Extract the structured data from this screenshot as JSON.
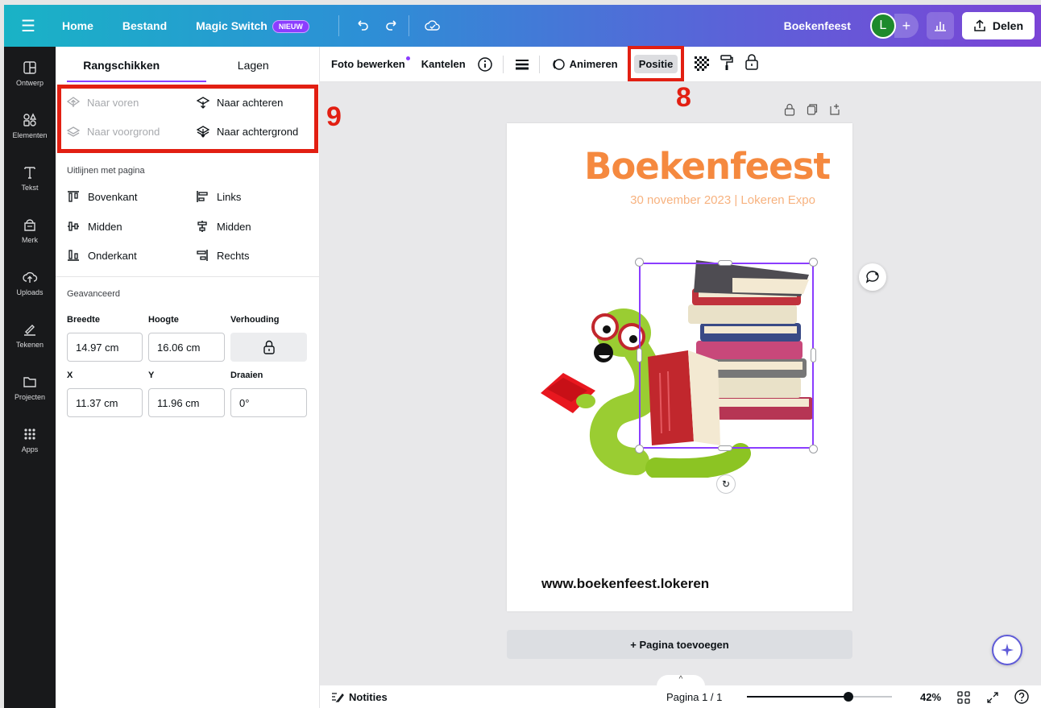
{
  "topbar": {
    "home": "Home",
    "file": "Bestand",
    "magic_switch": "Magic Switch",
    "new_badge": "NIEUW",
    "doc_title": "Boekenfeest",
    "avatar_initial": "L",
    "share": "Delen"
  },
  "rail": [
    {
      "label": "Ontwerp",
      "icon": "layout-icon"
    },
    {
      "label": "Elementen",
      "icon": "shapes-icon"
    },
    {
      "label": "Tekst",
      "icon": "text-icon"
    },
    {
      "label": "Merk",
      "icon": "brand-icon"
    },
    {
      "label": "Uploads",
      "icon": "cloud-upload-icon"
    },
    {
      "label": "Tekenen",
      "icon": "draw-icon"
    },
    {
      "label": "Projecten",
      "icon": "folder-icon"
    },
    {
      "label": "Apps",
      "icon": "apps-grid-icon"
    }
  ],
  "panel": {
    "tab_arrange": "Rangschikken",
    "tab_layers": "Lagen",
    "order": {
      "forward": "Naar voren",
      "backward": "Naar achteren",
      "front": "Naar voorgrond",
      "back": "Naar achtergrond"
    },
    "align_heading": "Uitlijnen met pagina",
    "align": {
      "top": "Bovenkant",
      "left": "Links",
      "middle_v": "Midden",
      "middle_h": "Midden",
      "bottom": "Onderkant",
      "right": "Rechts"
    },
    "advanced_heading": "Geavanceerd",
    "width_label": "Breedte",
    "height_label": "Hoogte",
    "ratio_label": "Verhouding",
    "width_value": "14.97 cm",
    "height_value": "16.06 cm",
    "x_label": "X",
    "y_label": "Y",
    "rotate_label": "Draaien",
    "x_value": "11.37 cm",
    "y_value": "11.96 cm",
    "rotate_value": "0°"
  },
  "ctx": {
    "edit_photo": "Foto bewerken",
    "flip": "Kantelen",
    "animate": "Animeren",
    "position": "Positie"
  },
  "annotations": {
    "eight": "8",
    "nine": "9"
  },
  "design": {
    "title": "Boekenfeest",
    "subtitle": "30 november 2023 | Lokeren Expo",
    "url": "www.boekenfeest.lokeren"
  },
  "add_page": "+ Pagina toevoegen",
  "bottom": {
    "notes": "Notities",
    "page_indicator": "Pagina 1 / 1",
    "zoom": "42%",
    "zoom_level": 0.42
  },
  "colors": {
    "accent": "#8b3dff",
    "annotation_red": "#e21f12",
    "title_orange": "#f5893f"
  }
}
